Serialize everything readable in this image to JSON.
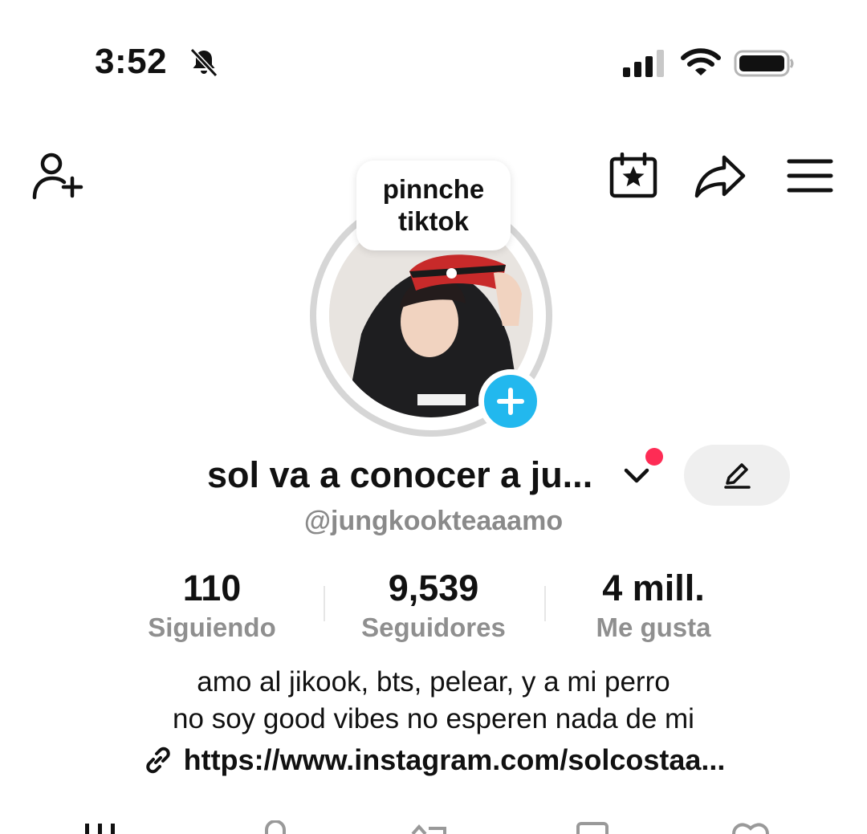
{
  "status_bar": {
    "time": "3:52"
  },
  "profile": {
    "note": [
      "pinnche",
      "tiktok"
    ],
    "display_name": "sol va a conocer a ju...",
    "username": "@jungkookteaaamo"
  },
  "stats": [
    {
      "value": "110",
      "label": "Siguiendo"
    },
    {
      "value": "9,539",
      "label": "Seguidores"
    },
    {
      "value": "4 mill.",
      "label": "Me gusta"
    }
  ],
  "bio": {
    "line1": "amo al jikook, bts, pelear,  y a mi perro",
    "line2": "no soy good vibes no esperen nada de mi",
    "link": "https://www.instagram.com/solcostaa..."
  },
  "colors": {
    "accent_blue": "#22b8ee",
    "notification_red": "#fe2c55",
    "muted_text": "#8a8a8a"
  },
  "icons": [
    "bell-slash-icon",
    "signal-icon",
    "wifi-icon",
    "battery-icon",
    "add-user-icon",
    "calendar-star-icon",
    "share-icon",
    "menu-icon",
    "plus-icon",
    "chevron-down-icon",
    "pencil-icon",
    "link-icon",
    "grid-tab-icon",
    "lock-tab-icon",
    "repost-tab-icon",
    "bookmark-tab-icon",
    "heart-tab-icon"
  ]
}
